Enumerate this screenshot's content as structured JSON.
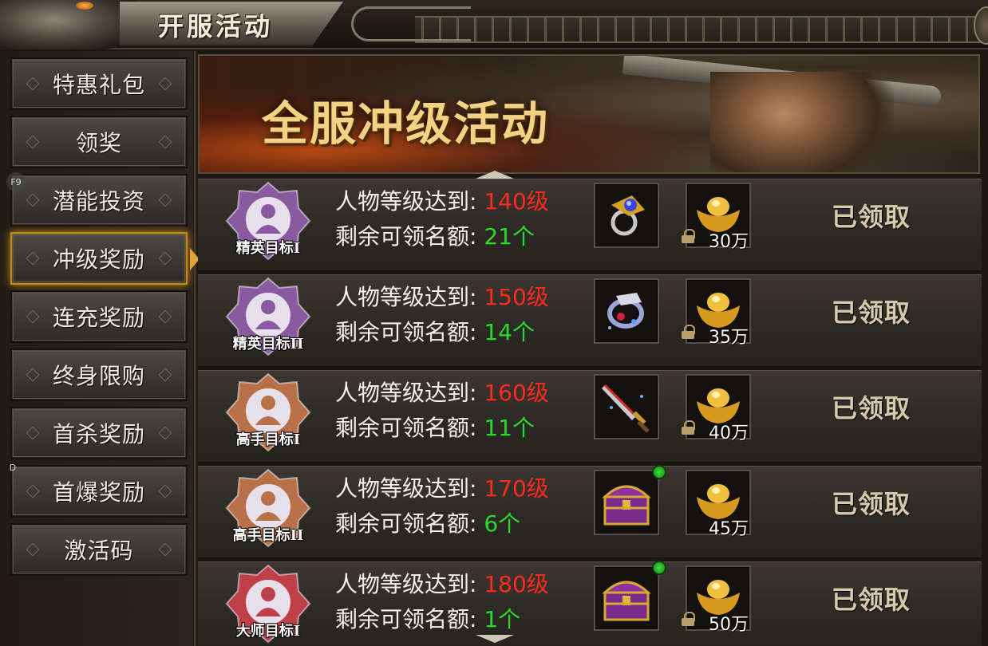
{
  "header": {
    "title": "开服活动"
  },
  "sidebar": {
    "items": [
      {
        "label": "特惠礼包",
        "active": false
      },
      {
        "label": "领奖",
        "active": false
      },
      {
        "label": "潜能投资",
        "active": false
      },
      {
        "label": "冲级奖励",
        "active": true
      },
      {
        "label": "连充奖励",
        "active": false
      },
      {
        "label": "终身限购",
        "active": false
      },
      {
        "label": "首杀奖励",
        "active": false
      },
      {
        "label": "首爆奖励",
        "active": false
      },
      {
        "label": "激活码",
        "active": false
      }
    ],
    "hotkeys": [
      "F9",
      "D"
    ]
  },
  "banner": {
    "title": "全服冲级活动"
  },
  "rewards": [
    {
      "badge": "精英目标I",
      "badge_color": "#8a5aa0",
      "level_label": "人物等级达到:",
      "level_value": "140级",
      "quota_label": "剩余可领名额:",
      "quota_value": "21个",
      "item_icon": "ring-icon",
      "gold_amount": "30万",
      "locked": true,
      "new_dot": false,
      "status": "已领取"
    },
    {
      "badge": "精英目标II",
      "badge_color": "#8a5aa0",
      "level_label": "人物等级达到:",
      "level_value": "150级",
      "quota_label": "剩余可领名额:",
      "quota_value": "14个",
      "item_icon": "bracelet-icon",
      "gold_amount": "35万",
      "locked": true,
      "new_dot": false,
      "status": "已领取"
    },
    {
      "badge": "高手目标I",
      "badge_color": "#b87048",
      "level_label": "人物等级达到:",
      "level_value": "160级",
      "quota_label": "剩余可领名额:",
      "quota_value": "11个",
      "item_icon": "sword-icon",
      "gold_amount": "40万",
      "locked": true,
      "new_dot": false,
      "status": "已领取"
    },
    {
      "badge": "高手目标II",
      "badge_color": "#b87048",
      "level_label": "人物等级达到:",
      "level_value": "170级",
      "quota_label": "剩余可领名额:",
      "quota_value": "6个",
      "item_icon": "treasure-chest-icon",
      "gold_amount": "45万",
      "locked": false,
      "new_dot": true,
      "status": "已领取"
    },
    {
      "badge": "大师目标I",
      "badge_color": "#c0404a",
      "level_label": "人物等级达到:",
      "level_value": "180级",
      "quota_label": "剩余可领名额:",
      "quota_value": "1个",
      "item_icon": "treasure-chest-icon",
      "gold_amount": "50万",
      "locked": true,
      "new_dot": true,
      "status": "已领取"
    }
  ]
}
